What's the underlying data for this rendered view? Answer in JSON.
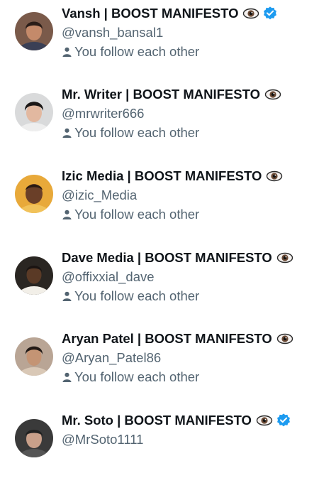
{
  "users": [
    {
      "name": "Vansh | BOOST MANIFESTO",
      "handle": "@vansh_bansal1",
      "follow_status": "You follow each other",
      "verified": true,
      "eye_emoji": "eye-icon",
      "avatar_colors": {
        "bg": "#7a5a4a",
        "skin": "#c48a6a",
        "hair": "#2a1d18",
        "shirt": "#3a3f55"
      }
    },
    {
      "name": "Mr. Writer | BOOST MANIFESTO",
      "handle": "@mrwriter666",
      "follow_status": "You follow each other",
      "verified": false,
      "eye_emoji": "eye-icon",
      "avatar_colors": {
        "bg": "#d9dadb",
        "skin": "#e2b8a0",
        "hair": "#1b1716",
        "shirt": "#eeeeee"
      }
    },
    {
      "name": "Izic Media | BOOST MANIFESTO",
      "handle": "@izic_Media",
      "follow_status": "You follow each other",
      "verified": false,
      "eye_emoji": "eye-icon",
      "avatar_colors": {
        "bg": "#e8a93a",
        "skin": "#6a3f28",
        "hair": "#2a1a12",
        "shirt": "#f1c25a"
      }
    },
    {
      "name": "Dave Media | BOOST MANIFESTO",
      "handle": "@offixxial_dave",
      "follow_status": "You follow each other",
      "verified": false,
      "eye_emoji": "eye-icon",
      "avatar_colors": {
        "bg": "#2a2622",
        "skin": "#5a3a26",
        "hair": "#1a1412",
        "shirt": "#f2efe8"
      }
    },
    {
      "name": "Aryan Patel | BOOST MANIFESTO",
      "handle": "@Aryan_Patel86",
      "follow_status": "You follow each other",
      "verified": false,
      "eye_emoji": "eye-icon",
      "avatar_colors": {
        "bg": "#b9a595",
        "skin": "#c49474",
        "hair": "#221a16",
        "shirt": "#d9c8b6"
      }
    },
    {
      "name": "Mr. Soto | BOOST MANIFESTO",
      "handle": "@MrSoto1111",
      "follow_status": "",
      "verified": true,
      "eye_emoji": "eye-icon",
      "avatar_colors": {
        "bg": "#3a3a3a",
        "skin": "#c9a08a",
        "hair": "#222222",
        "shirt": "#555555"
      }
    }
  ],
  "colors": {
    "name_text": "#0f1419",
    "secondary_text": "#536471",
    "verified_blue": "#1d9bf0"
  }
}
